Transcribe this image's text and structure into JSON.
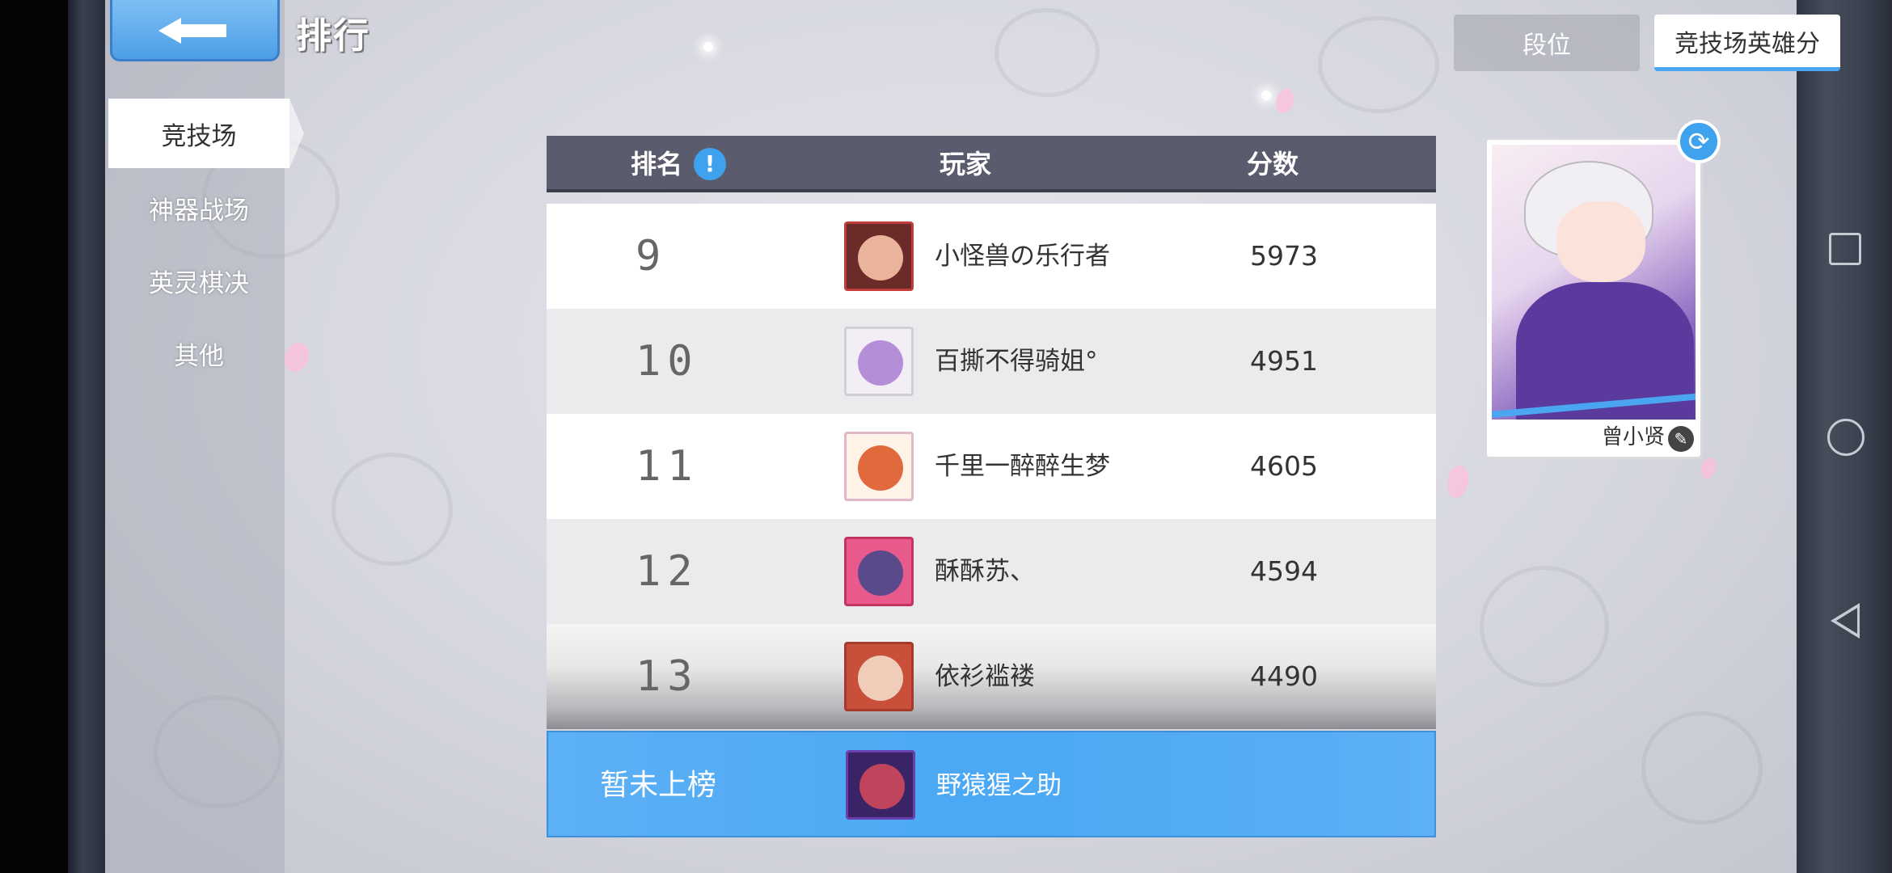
{
  "header": {
    "title": "排行"
  },
  "sidebar": {
    "items": [
      {
        "label": "竞技场",
        "active": true
      },
      {
        "label": "神器战场",
        "active": false
      },
      {
        "label": "英灵棋决",
        "active": false
      },
      {
        "label": "其他",
        "active": false
      }
    ]
  },
  "tabs": [
    {
      "label": "段位",
      "active": false
    },
    {
      "label": "竞技场英雄分",
      "active": true
    }
  ],
  "table": {
    "columns": {
      "rank": "排名",
      "player": "玩家",
      "score": "分数"
    },
    "rows": [
      {
        "rank": "9",
        "player": "小怪兽の乐行者",
        "score": "5973",
        "avatar_color": "#a33a32"
      },
      {
        "rank": "10",
        "player": "百撕不得骑姐°",
        "score": "4951",
        "avatar_color": "#b58ed8"
      },
      {
        "rank": "11",
        "player": "千里一醉醉生梦",
        "score": "4605",
        "avatar_color": "#e06a3c"
      },
      {
        "rank": "12",
        "player": "酥酥苏、",
        "score": "4594",
        "avatar_color": "#5a4a8c"
      },
      {
        "rank": "13",
        "player": "依衫褴褛",
        "score": "4490",
        "avatar_color": "#e8b49a"
      }
    ]
  },
  "my_row": {
    "status": "暂未上榜",
    "player": "野猿猩之助",
    "avatar_color": "#6a3fb2"
  },
  "hero_card": {
    "name": "曾小贤"
  },
  "colors": {
    "accent": "#4aa6f0",
    "header_bg": "#5a5b6c",
    "my_row_bg": "#4aa8f4"
  }
}
